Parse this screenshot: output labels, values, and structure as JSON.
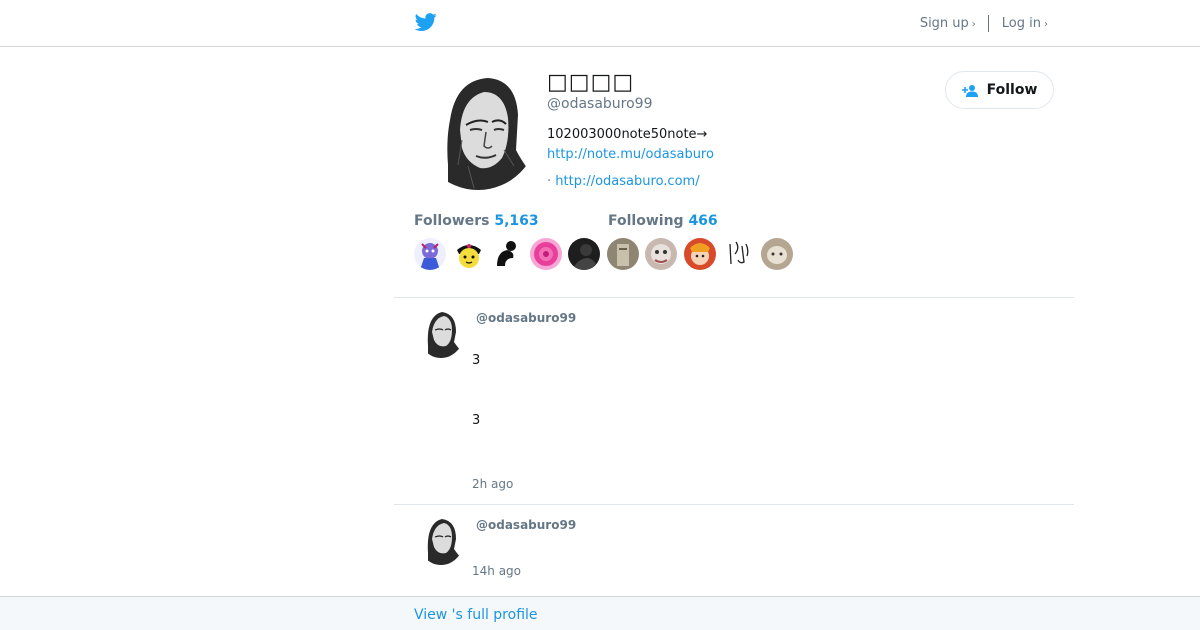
{
  "header": {
    "logo_icon": "twitter-bird-icon",
    "signup_label": "Sign up",
    "login_label": "Log in",
    "chevron": "›"
  },
  "profile": {
    "name": "□□□□",
    "handle": "@odasaburo99",
    "bio_text": "102003000note50note→",
    "bio_link": "http://note.mu/odasaburo",
    "location_prefix": "·",
    "website": "http://odasaburo.com/",
    "follow_label": "Follow"
  },
  "stats": {
    "followers_label": "Followers",
    "followers_count": "5,163",
    "following_label": "Following",
    "following_count": "466"
  },
  "tweets": [
    {
      "handle": "@odasaburo99",
      "lines": [
        "3",
        "3"
      ],
      "time": "2h ago"
    },
    {
      "handle": "@odasaburo99",
      "lines": [],
      "time": "14h ago"
    }
  ],
  "footer": {
    "view_profile_label": "View 's full profile"
  },
  "colors": {
    "brand_blue": "#1da1f2",
    "link_blue": "#1b95e0",
    "muted": "#657786"
  }
}
